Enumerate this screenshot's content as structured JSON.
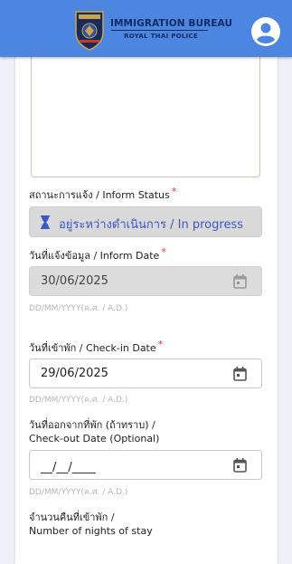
{
  "header": {
    "title": "IMMIGRATION BUREAU",
    "subtitle": "ROYAL THAI POLICE",
    "bar_color": "#4d86e0",
    "logo_icon": "immigration-badge-icon",
    "profile_icon": "account-circle-icon"
  },
  "form": {
    "inform_status": {
      "label": "สถานะการแจ้ง / Inform Status",
      "required_mark": "*",
      "value": "อยู่ระหว่างดำเนินการ / In progress",
      "icon": "hourglass-icon"
    },
    "inform_date": {
      "label": "วันที่แจ้งข้อมูล / Inform Date",
      "required_mark": "*",
      "value": "30/06/2025",
      "hint": "DD/MM/YYYY(ค.ศ. / A.D.)"
    },
    "checkin_date": {
      "label": "วันที่เข้าพัก / Check-in Date",
      "required_mark": "*",
      "value": "29/06/2025",
      "hint": "DD/MM/YYYY(ค.ศ. / A.D.)"
    },
    "checkout_date": {
      "label_line1": "วันที่ออกจากที่พัก (ถ้าทราบ) /",
      "label_line2": "Check-out Date (Optional)",
      "value": "__/__/____",
      "hint": "DD/MM/YYYY(ค.ศ. / A.D.)"
    },
    "nights": {
      "label_line1": "จำนวนคืนที่เข้าพัก /",
      "label_line2": "Number of nights of stay"
    }
  }
}
